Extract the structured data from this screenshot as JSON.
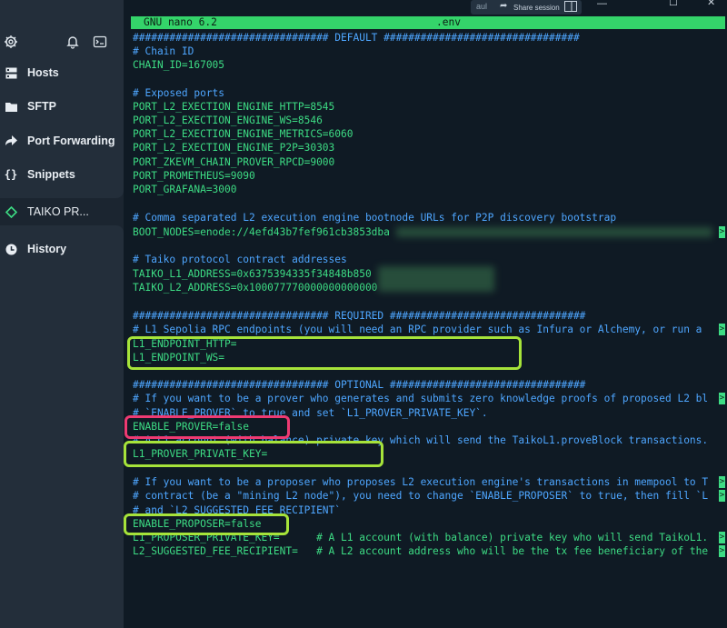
{
  "sidebar": {
    "items": [
      {
        "label": "Hosts",
        "icon": "hosts-icon"
      },
      {
        "label": "SFTP",
        "icon": "folder-icon"
      },
      {
        "label": "Port Forwarding",
        "icon": "forward-icon"
      },
      {
        "label": "Snippets",
        "icon": "braces-icon"
      },
      {
        "label": "TAIKO PR...",
        "icon": "connection-icon"
      },
      {
        "label": "History",
        "icon": "clock-icon"
      }
    ]
  },
  "window": {
    "share_label": "Share session",
    "input_text": "aul"
  },
  "editor": {
    "app": "GNU nano 6.2",
    "filename": ".env",
    "lines": {
      "l1": "################################ DEFAULT ################################",
      "l2": "# Chain ID",
      "l3": "CHAIN_ID=167005",
      "l5": "# Exposed ports",
      "l6": "PORT_L2_EXECTION_ENGINE_HTTP=8545",
      "l7": "PORT_L2_EXECTION_ENGINE_WS=8546",
      "l8": "PORT_L2_EXECTION_ENGINE_METRICS=6060",
      "l9": "PORT_L2_EXECTION_ENGINE_P2P=30303",
      "l10": "PORT_ZKEVM_CHAIN_PROVER_RPCD=9000",
      "l11": "PORT_PROMETHEUS=9090",
      "l12": "PORT_GRAFANA=3000",
      "l14": "# Comma separated L2 execution engine bootnode URLs for P2P discovery bootstrap",
      "l15": "BOOT_NODES=enode://4efd43b7fef961cb3853dba",
      "l17": "# Taiko protocol contract addresses",
      "l18": "TAIKO_L1_ADDRESS=0x6375394335f34848b850",
      "l19": "TAIKO_L2_ADDRESS=0x100077770000000000000",
      "l21": "################################ REQUIRED ################################",
      "l22": "# L1 Sepolia RPC endpoints (you will need an RPC provider such as Infura or Alchemy, or run a",
      "l23": "L1_ENDPOINT_HTTP=",
      "l24": "L1_ENDPOINT_WS=",
      "l26": "################################ OPTIONAL ################################",
      "l27": "# If you want to be a prover who generates and submits zero knowledge proofs of proposed L2 bl",
      "l28": "# `ENABLE_PROVER` to true and set `L1_PROVER_PRIVATE_KEY`.",
      "l29": "ENABLE_PROVER=false",
      "l30": "# A L1 account (with balance) private key which will send the TaikoL1.proveBlock transactions.",
      "l31": "L1_PROVER_PRIVATE_KEY=",
      "l33": "# If you want to be a proposer who proposes L2 execution engine's transactions in mempool to T",
      "l34": "# contract (be a \"mining L2 node\"), you need to change `ENABLE_PROPOSER` to true, then fill `L",
      "l35": "# and `L2_SUGGESTED_FEE_RECIPIENT`",
      "l36": "ENABLE_PROPOSER=false",
      "l37": "L1_PROPOSER_PRIVATE_KEY=      # A L1 account (with balance) private key who will send TaikoL1.",
      "l38": "L2_SUGGESTED_FEE_RECIPIENT=   # A L2 account address who will be the tx fee beneficiary of the"
    }
  },
  "colors": {
    "highlight_green": "#a6e33a",
    "highlight_pink": "#ee3a72",
    "text_green": "#3ddc84",
    "comment_blue": "#4ea6ff"
  }
}
